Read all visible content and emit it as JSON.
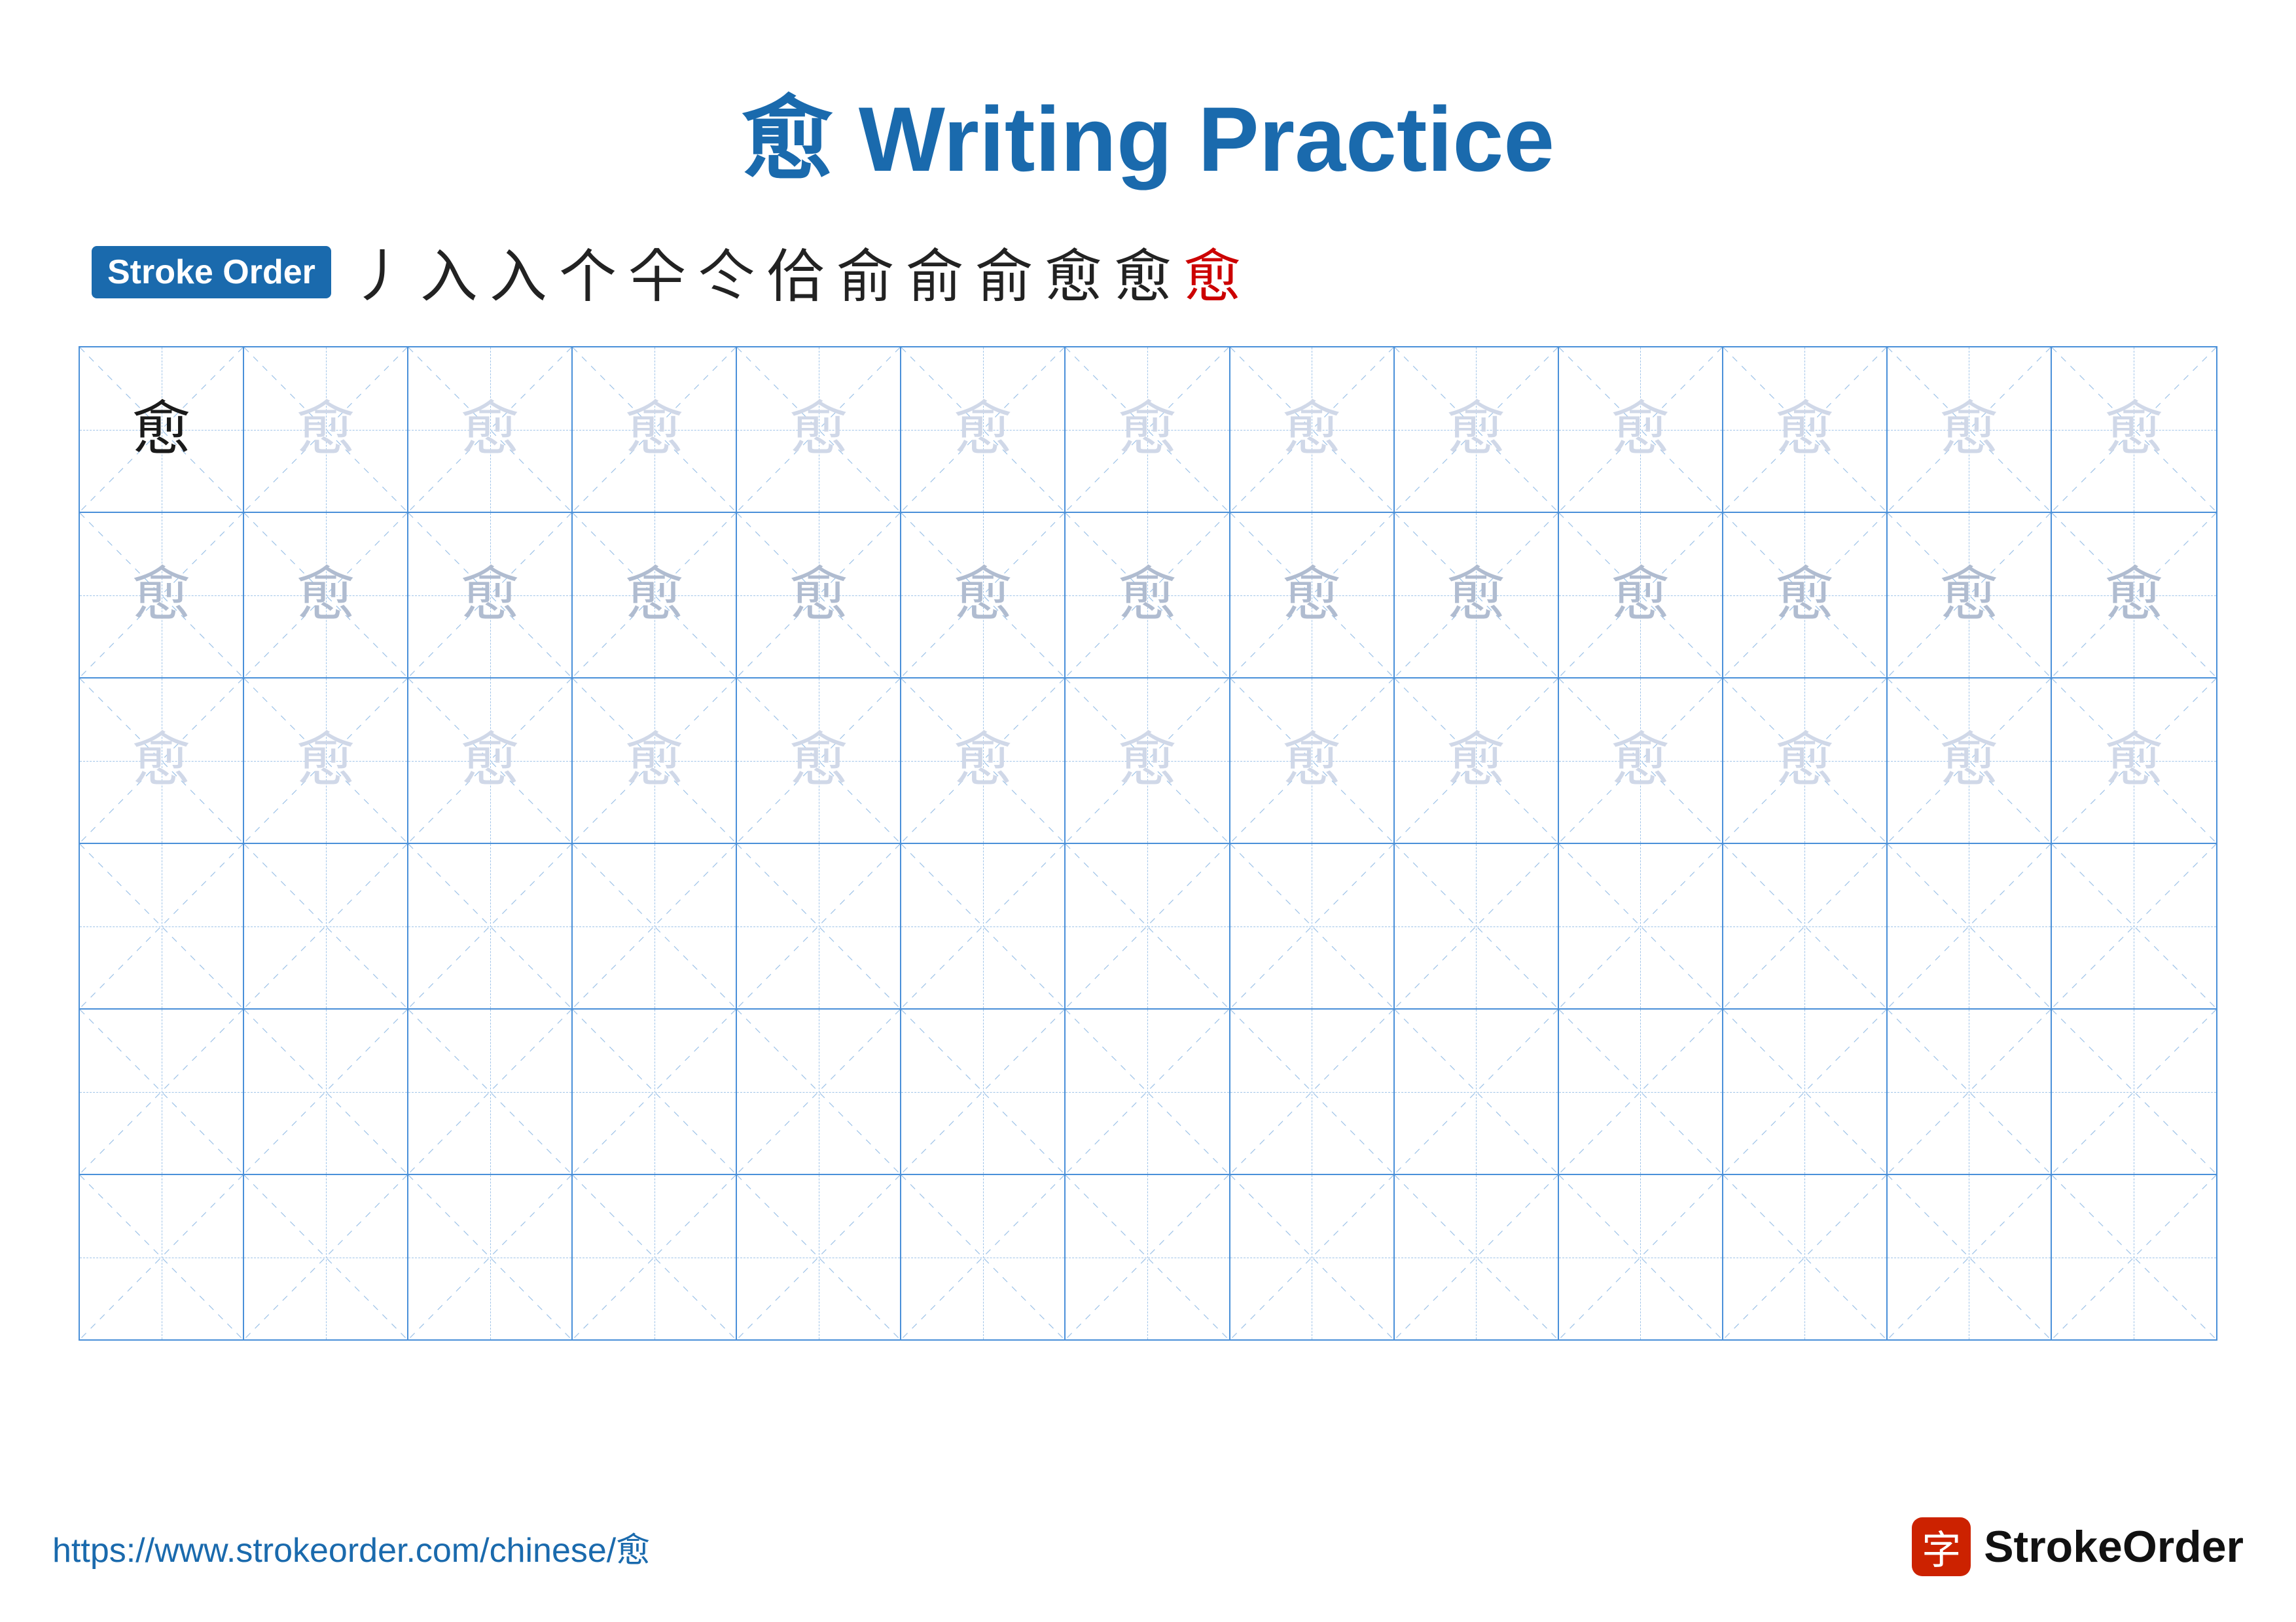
{
  "title": {
    "char": "愈",
    "text": "Writing Practice"
  },
  "stroke_order": {
    "badge_label": "Stroke Order",
    "strokes": [
      "丿",
      "入",
      "入",
      "个",
      "仐",
      "仒",
      "佮",
      "俞",
      "俞",
      "俞",
      "愈",
      "愈",
      "愈"
    ]
  },
  "grid": {
    "rows": 6,
    "cols": 13,
    "char": "愈",
    "row1_first_dark": true,
    "guide_char_rows": 3
  },
  "footer": {
    "url": "https://www.strokeorder.com/chinese/愈",
    "brand_char": "字",
    "brand_name": "StrokeOrder"
  }
}
